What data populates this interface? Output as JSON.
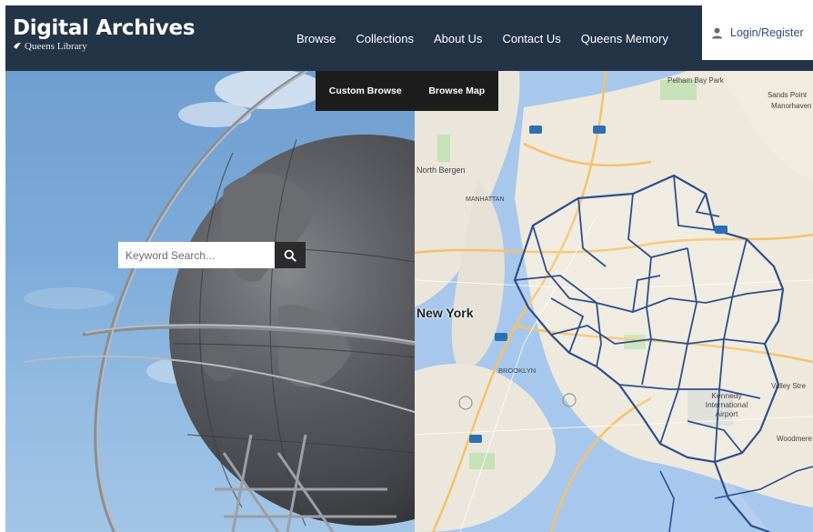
{
  "header": {
    "title": "Digital Archives",
    "subtitle": "Queens Library",
    "nav": [
      {
        "label": "Browse"
      },
      {
        "label": "Collections"
      },
      {
        "label": "About Us"
      },
      {
        "label": "Contact Us"
      },
      {
        "label": "Queens Memory"
      }
    ],
    "login_label": "Login/Register"
  },
  "browse_menu": [
    {
      "label": "Custom Browse"
    },
    {
      "label": "Browse Map"
    }
  ],
  "search": {
    "placeholder": "Keyword Search..."
  },
  "map_labels": {
    "new_york": "New York",
    "north_bergen": "North Bergen",
    "manhattan": "MANHATTAN",
    "brooklyn": "BROOKLYN",
    "airport": "Kennedy International Airport",
    "pelham": "Pelham Bay Park",
    "sands_point": "Sands Point",
    "manorhaven": "Manorhaven",
    "valley_stream": "Valley Stre",
    "woodmere": "Woodmere"
  },
  "colors": {
    "header_bg": "#243447",
    "login_text": "#2a4d74",
    "boundary": "#2e4f8c",
    "water": "#a7c7ec"
  }
}
